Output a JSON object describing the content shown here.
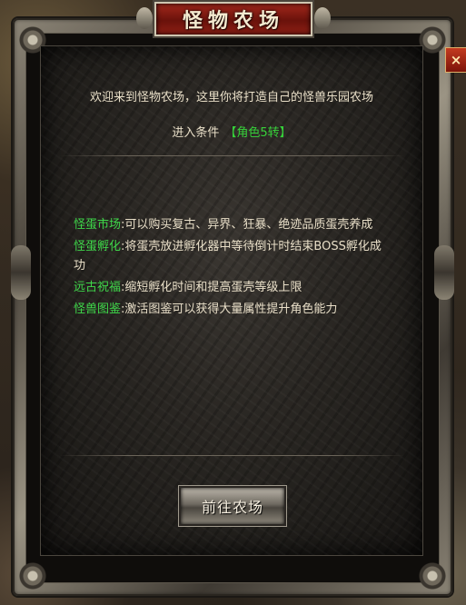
{
  "title": "怪物农场",
  "close_label": "×",
  "intro": "欢迎来到怪物农场，这里你将打造自己的怪兽乐园农场",
  "condition": {
    "label": "进入条件",
    "value": "【角色5转】"
  },
  "features": [
    {
      "name": "怪蛋市场",
      "desc": ":可以购买复古、异界、狂暴、绝迹品质蛋壳养成"
    },
    {
      "name": "怪蛋孵化",
      "desc": ":将蛋壳放进孵化器中等待倒计时结束BOSS孵化成功"
    },
    {
      "name": "远古祝福",
      "desc": ":缩短孵化时间和提高蛋壳等级上限"
    },
    {
      "name": "怪兽图鉴",
      "desc": ":激活图鉴可以获得大量属性提升角色能力"
    }
  ],
  "go_button": "前往农场",
  "colors": {
    "accent_green": "#3fd84a",
    "title_red": "#8e1f15",
    "text": "#e9dfc8"
  }
}
